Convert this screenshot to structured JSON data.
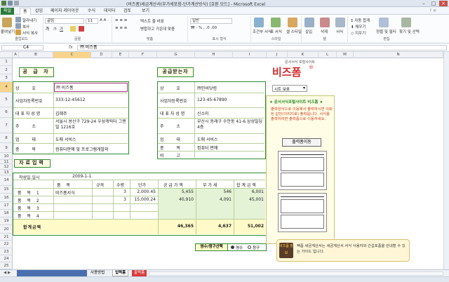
{
  "window": {
    "title": "(비즈폼)세금계산서(부가세포함-단가계산방식) [호환 모드] - Microsoft Excel"
  },
  "tabs": [
    "파일",
    "홈",
    "삽입",
    "페이지 레이아웃",
    "수식",
    "데이터",
    "검토",
    "보기"
  ],
  "ribbon": {
    "paste": "붙여넣기",
    "cut": "잘라내기",
    "copy": "복사",
    "format_painter": "서식 복사",
    "clipboard_label": "클립보드",
    "font_name": "굴림",
    "font_size": "11",
    "font_label": "글꼴",
    "align_label": "맞춤",
    "wrap": "텍스트 줄 바꿈",
    "merge": "병합하고 가운데 맞춤",
    "number_format": "일반",
    "number_label": "표시 형식",
    "styles": [
      "조건부 서식",
      "표 서식",
      "셀 스타일"
    ],
    "styles_label": "스타일",
    "cells": [
      "삽입",
      "삭제",
      "서식"
    ],
    "cells_label": "셀",
    "autosum": "자동 합계",
    "fill": "채우기",
    "clear": "지우기",
    "sort": "정렬 및 필터",
    "find": "찾기 및 선택",
    "edit_label": "편집"
  },
  "formula_bar": {
    "name_box": "C4",
    "fx": "fx",
    "value": "㈜ 비즈폼"
  },
  "columns": [
    "A",
    "B",
    "C",
    "D",
    "E",
    "F",
    "G",
    "H",
    "I",
    "J",
    "K",
    "L",
    "M",
    "N"
  ],
  "rows": [
    "1",
    "2",
    "3",
    "4",
    "5",
    "6",
    "7",
    "8",
    "9",
    "10",
    "11",
    "12",
    "13",
    "14",
    "15",
    "16",
    "17",
    "18",
    "19",
    "20",
    "21",
    "22",
    "23",
    "24",
    "25",
    "26"
  ],
  "selected": {
    "column": "C",
    "row": "4"
  },
  "supplier": {
    "title": "공 급 자",
    "labels": [
      "상 호",
      "사업자등록번호",
      "대 표 자 성 명",
      "주 소",
      "업 태",
      "종 목"
    ],
    "values": [
      "㈜ 비즈폼",
      "333-12-45612",
      "김혜주",
      "서울시 용산구 729-24 우성캐릭터 그랜빌 1216호",
      "도매 서비스",
      "컴퓨터판매 및 프로그램개발외"
    ]
  },
  "receiver": {
    "title": "공급받는자",
    "labels": [
      "상 호",
      "사업자등록번호",
      "대 표 자 성 명",
      "주 소",
      "업 태",
      "종 목",
      "비 고"
    ],
    "values": [
      "㈜인비닷컴",
      "123-45-67890",
      "신소미",
      "부산시 동래구 수안동 41-6 삼성빌딩 4층",
      "도매 서비스",
      "컴퓨터 판매",
      ""
    ]
  },
  "data_input": {
    "title": "자료입력",
    "date_label": "작성일.일시",
    "date_value": "2009-1-1",
    "headers": [
      "품 목",
      "규격",
      "수량",
      "단가",
      "공 급 가 액",
      "부 가 세",
      "합 계 금 액"
    ],
    "rows": [
      {
        "label": "품 목 1",
        "item": "비즈폼서식",
        "spec": "",
        "qty": "3",
        "price": "2,000.45",
        "supply": "5,455",
        "vat": "546",
        "total": "6,001"
      },
      {
        "label": "품 목 2",
        "item": "",
        "spec": "",
        "qty": "3",
        "price": "15,000.24",
        "supply": "40,910",
        "vat": "4,091",
        "total": "45,001"
      },
      {
        "label": "품 목 3",
        "item": "",
        "spec": "",
        "qty": "",
        "price": "",
        "supply": "",
        "vat": "",
        "total": ""
      },
      {
        "label": "품 목 4",
        "item": "",
        "spec": "",
        "qty": "",
        "price": "",
        "supply": "",
        "vat": "",
        "total": ""
      }
    ],
    "total_label": "합계금액",
    "totals": {
      "supply": "46,365",
      "vat": "4,637",
      "total": "51,002"
    }
  },
  "receipt": {
    "title": "영수/청구선택",
    "options": [
      "영수",
      "청구"
    ],
    "selected": "영수"
  },
  "brand": {
    "tagline": "문서서식 포털사이트",
    "logo": "비즈폼"
  },
  "dropdown": {
    "value": "시트 보호"
  },
  "panel": {
    "heading": "★ 문서서식포털사이트 비즈폼 ★",
    "text": "출력양식으로 이동해서 출력하시면 의뢰된 값만(이미지로) 출력됩니다. 서식을 출력하려면 출력폼으로 이동하세요.",
    "button": "출력폼이동"
  },
  "note": {
    "badge": "비즈폼 정보",
    "text": "팩폼 세금계산서는 세금계산서 서식 사용자와 간섭포폼을 안내할 수 있는 가이드 입니다."
  },
  "sheets": [
    "사용방법",
    "입력폼",
    "출력폼"
  ],
  "active_sheet": "입력폼",
  "colors": {
    "accent_green": "#2e8b2e",
    "excel_green": "#2a7a3a",
    "logo_red": "#d42a2a",
    "selected_header": "#f6d48c"
  }
}
